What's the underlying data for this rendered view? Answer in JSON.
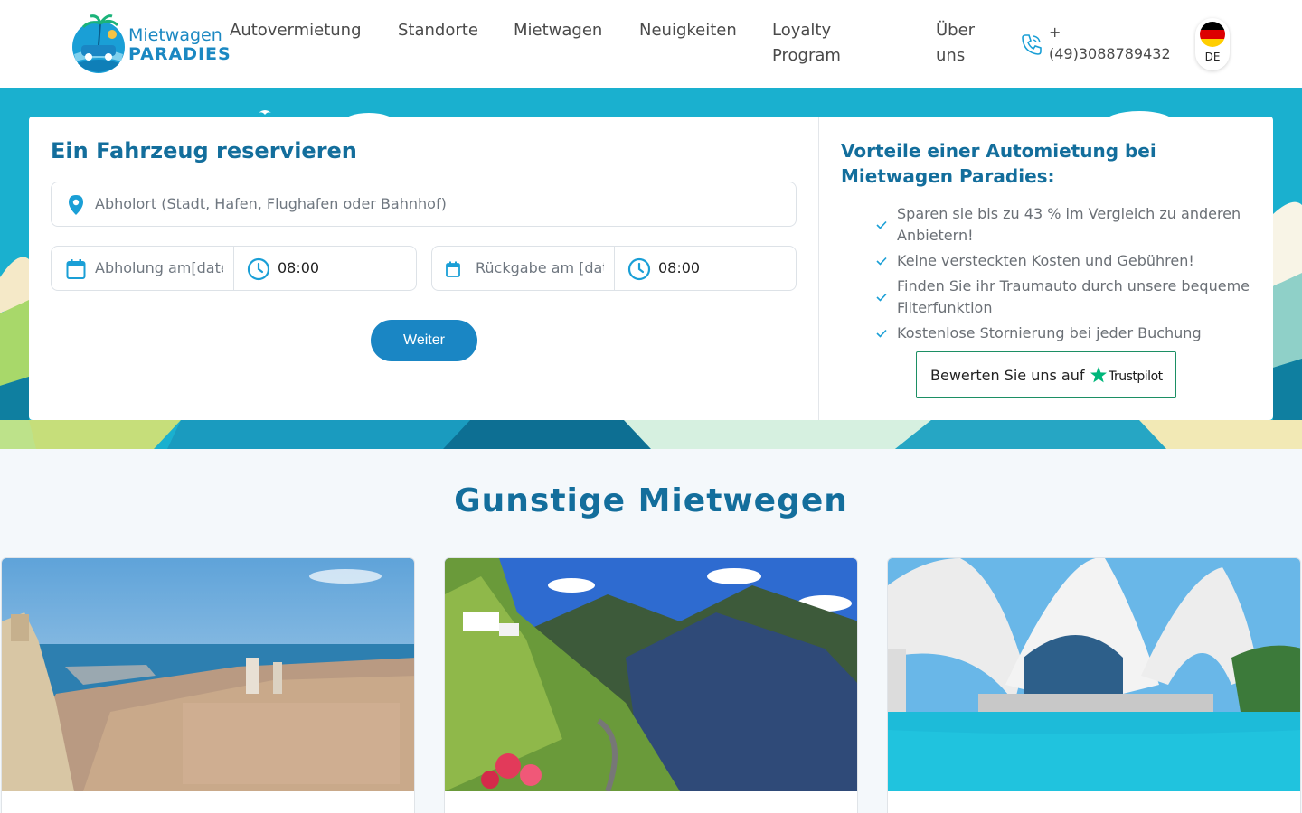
{
  "header": {
    "logo": {
      "line1": "Mietwagen",
      "line2": "PARADIES"
    },
    "nav": [
      {
        "label": "Autovermietung"
      },
      {
        "label": "Standorte"
      },
      {
        "label": "Mietwagen"
      },
      {
        "label": "Neuigkeiten"
      },
      {
        "label": "Loyalty Program"
      },
      {
        "label": "Über uns"
      }
    ],
    "phone": "+ (49)3088789432",
    "language": {
      "code": "DE",
      "flag_colors": [
        "#000000",
        "#dd0000",
        "#ffce00"
      ]
    }
  },
  "booking": {
    "title": "Ein Fahrzeug reservieren",
    "pickup_location_placeholder": "Abholort (Stadt, Hafen, Flughafen oder Bahnhof)",
    "pickup_date_placeholder": "Abholung am[date]",
    "pickup_time": "08:00",
    "return_date_placeholder": "Rückgabe am [date]",
    "return_time": "08:00",
    "submit_label": "Weiter"
  },
  "advantages": {
    "title": "Vorteile einer Automietung bei Mietwagen Paradies:",
    "items": [
      "Sparen sie bis zu 43 % im Vergleich zu anderen Anbietern!",
      "Keine versteckten Kosten und Gebühren!",
      "Finden Sie ihr Traumauto durch unsere bequeme Filterfunktion",
      "Kostenlose Stornierung bei jeder Buchung"
    ],
    "trustpilot_label": "Bewerten Sie uns auf",
    "trustpilot_brand": "Trustpilot"
  },
  "section": {
    "title": "Gunstige Mietwegen"
  },
  "colors": {
    "brand": "#1a86c4",
    "heading": "#136e9c",
    "hero_bg": "#1ab0cf",
    "trustpilot_green": "#00b67a"
  },
  "icons": [
    "location-pin-icon",
    "calendar-icon",
    "clock-icon",
    "phone-icon",
    "check-icon",
    "trustpilot-star-icon"
  ]
}
